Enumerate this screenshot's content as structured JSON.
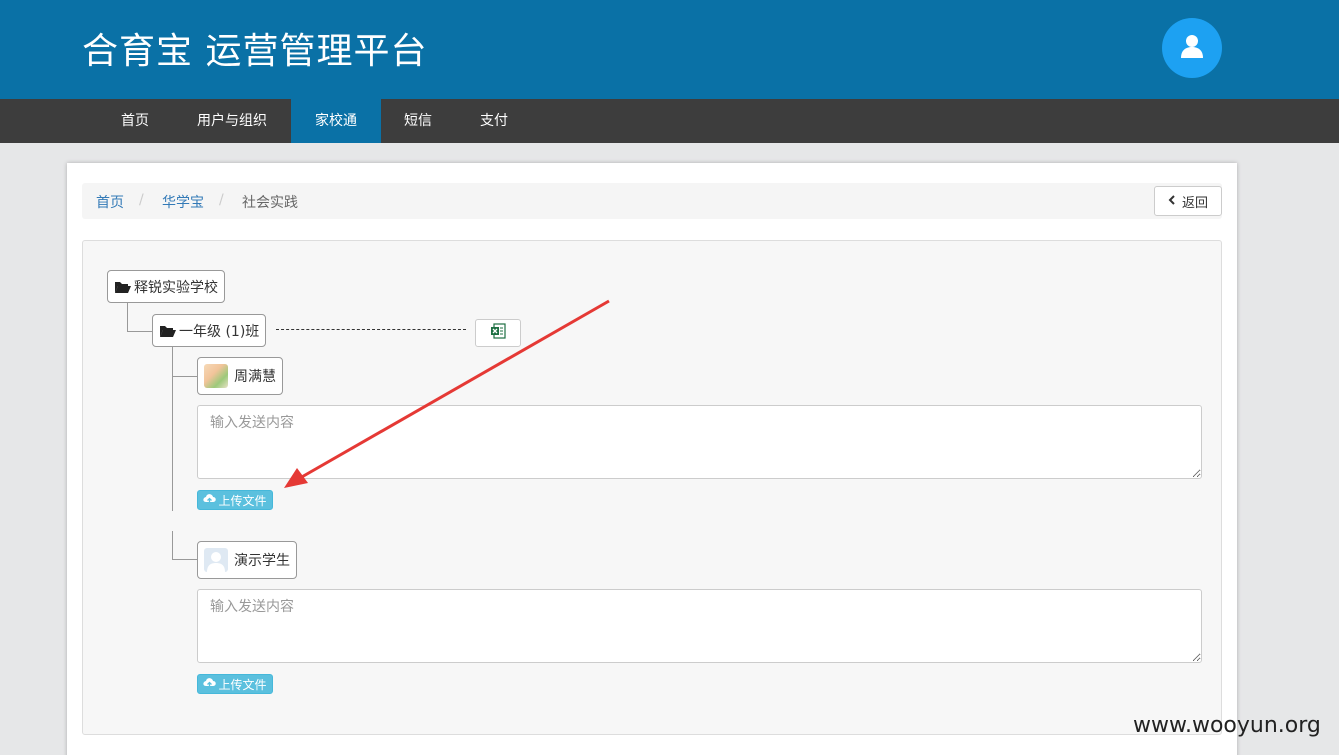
{
  "header": {
    "title": "合育宝 运营管理平台"
  },
  "nav": {
    "items": [
      {
        "label": "首页"
      },
      {
        "label": "用户与组织"
      },
      {
        "label": "家校通",
        "active": true
      },
      {
        "label": "短信"
      },
      {
        "label": "支付"
      }
    ]
  },
  "breadcrumb": {
    "items": [
      "首页",
      "华学宝",
      "社会实践"
    ],
    "separator": "/",
    "back_label": "返回"
  },
  "tree": {
    "school": "释锐实验学校",
    "class": "一年级 (1)班",
    "students": [
      {
        "name": "周满慧",
        "placeholder": "输入发送内容",
        "upload_label": "上传文件"
      },
      {
        "name": "演示学生",
        "placeholder": "输入发送内容",
        "upload_label": "上传文件"
      }
    ]
  },
  "watermark": "www.wooyun.org",
  "colors": {
    "header_bg": "#0a71a6",
    "nav_bg": "#3d3d3d",
    "nav_active": "#0a71a6",
    "upload_btn": "#5bc0de",
    "annotation_arrow": "#e53935"
  },
  "icons": {
    "user": "user-icon",
    "folder": "folder-open-icon",
    "excel": "excel-icon",
    "upload": "cloud-upload-icon",
    "back": "chevron-left-icon"
  }
}
